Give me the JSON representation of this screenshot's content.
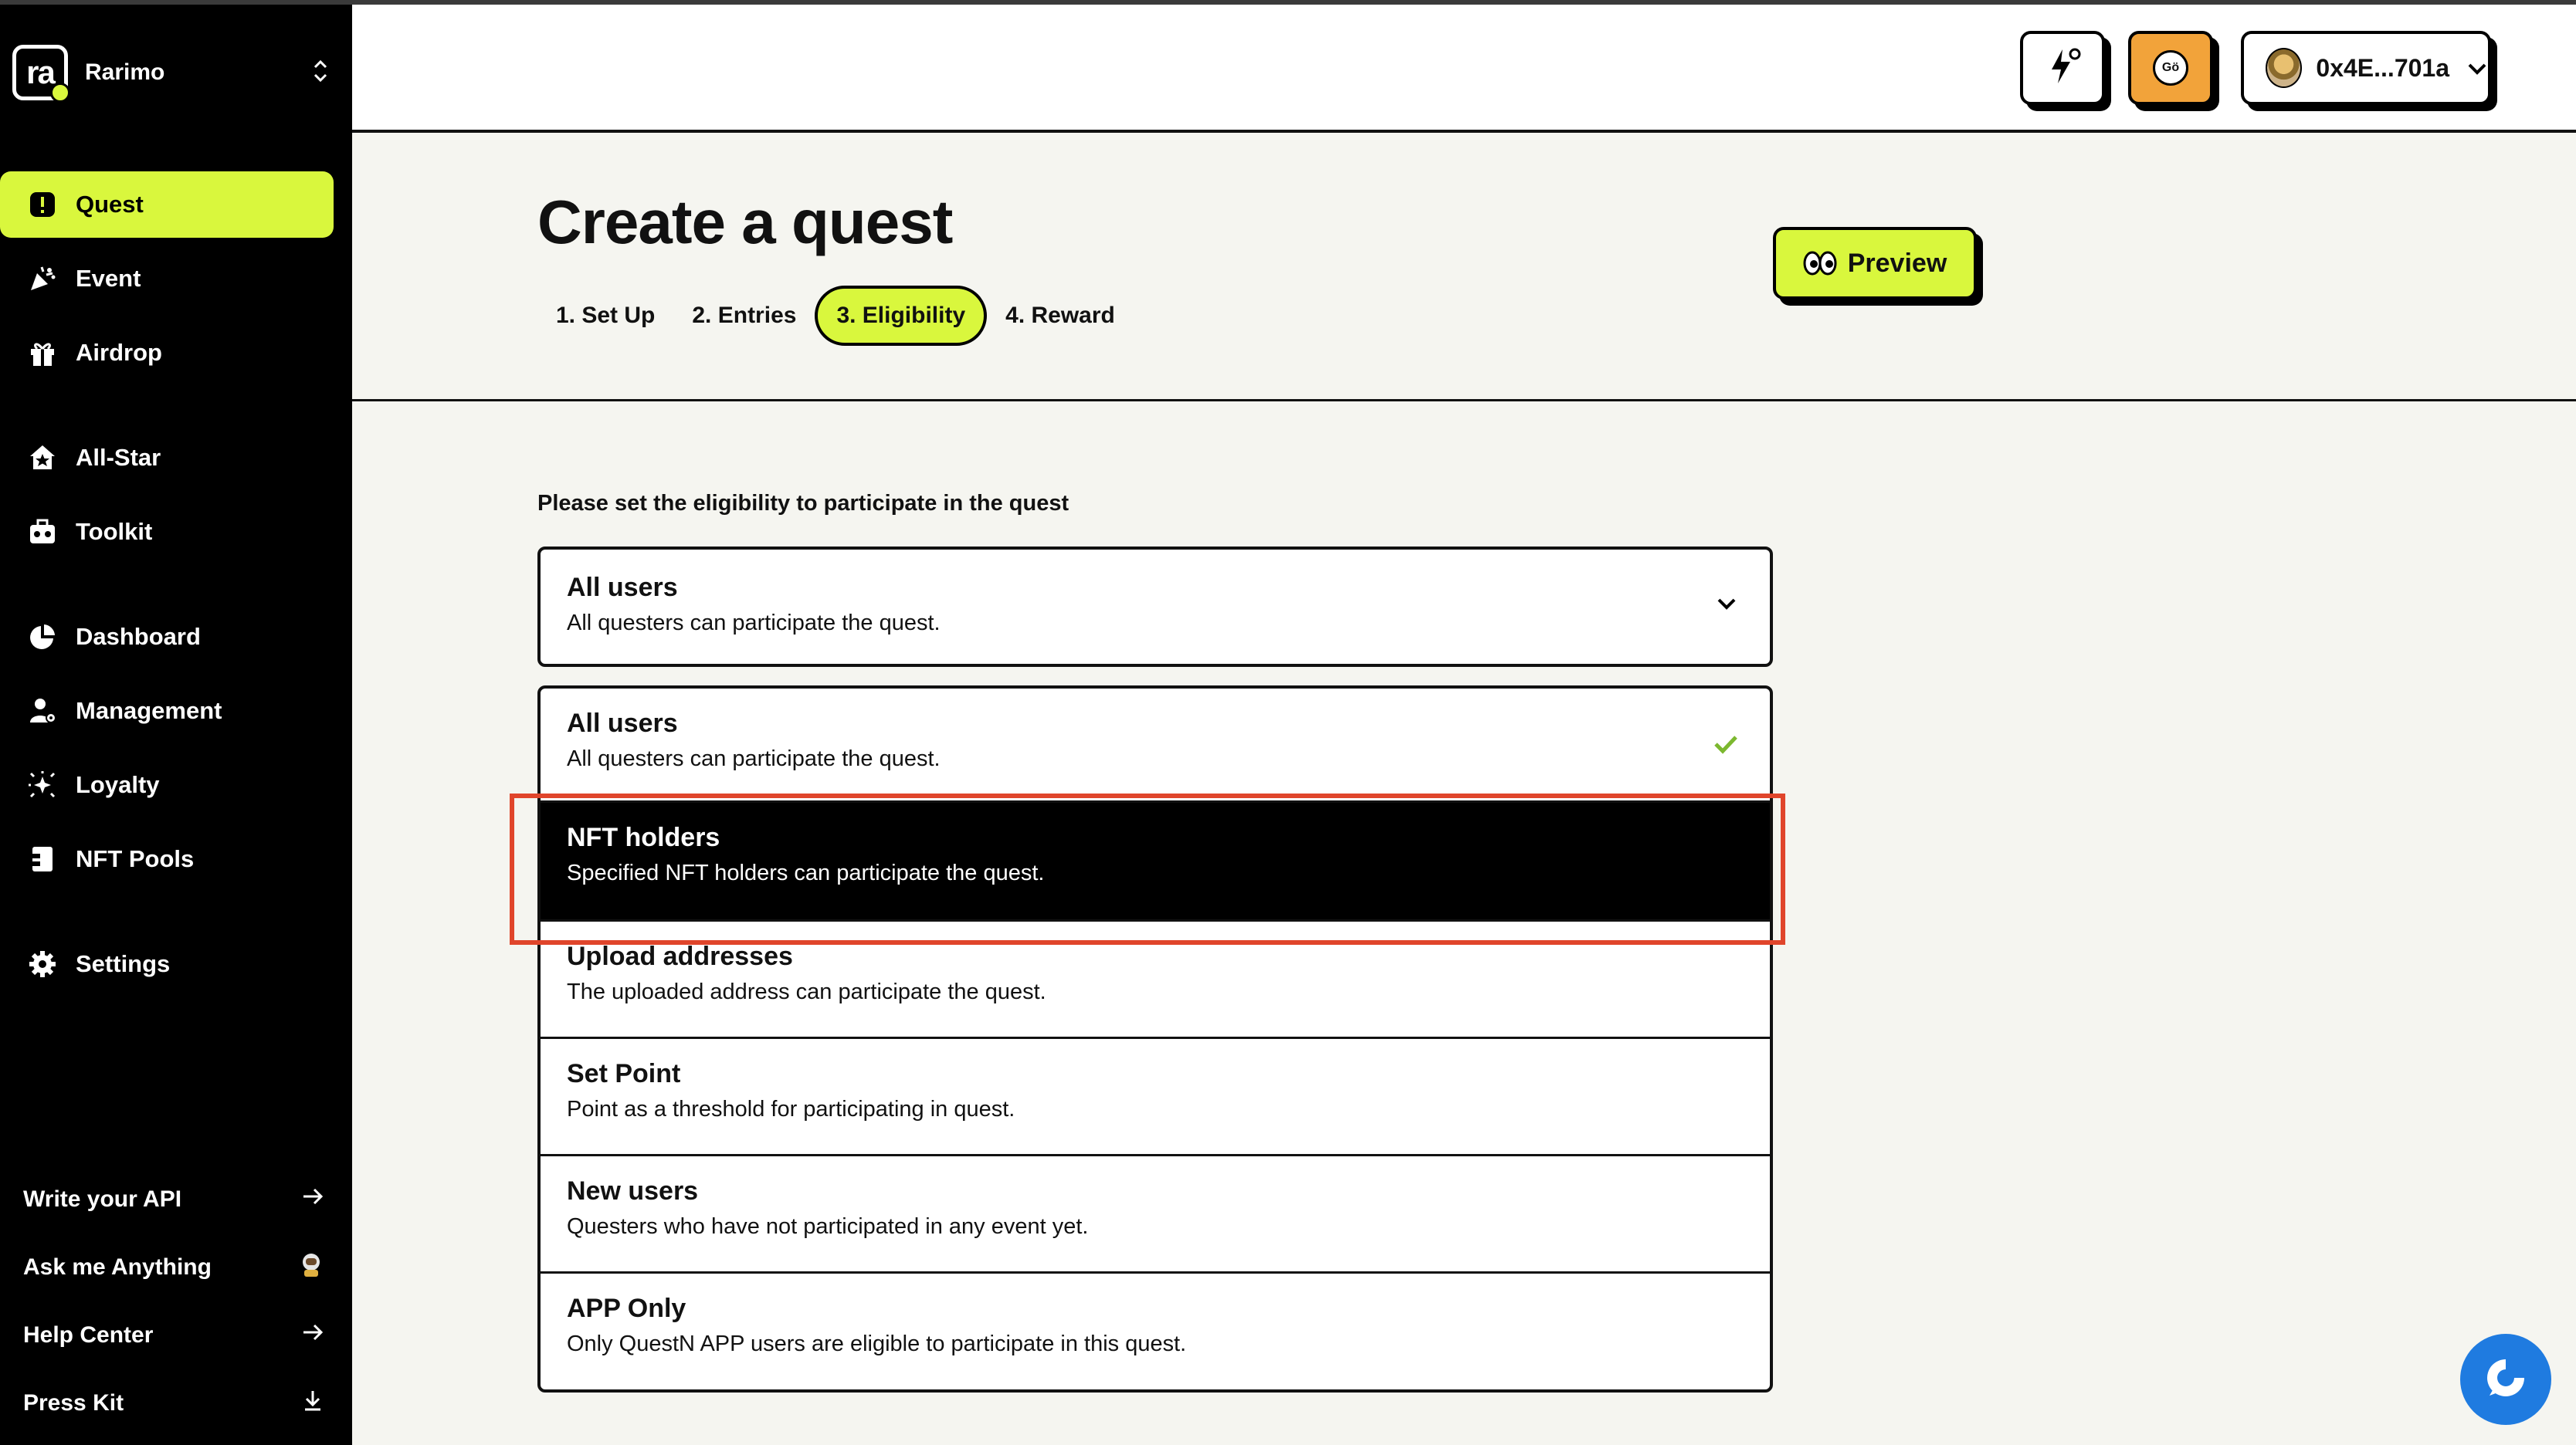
{
  "brand": {
    "name": "Rarimo",
    "logo_text": "ra"
  },
  "sidebar": {
    "items": [
      {
        "label": "Quest",
        "icon": "exclamation-icon",
        "active": true
      },
      {
        "label": "Event",
        "icon": "party-popper-icon"
      },
      {
        "label": "Airdrop",
        "icon": "gift-icon"
      },
      {
        "label": "All-Star",
        "icon": "star-house-icon"
      },
      {
        "label": "Toolkit",
        "icon": "toolkit-icon"
      },
      {
        "label": "Dashboard",
        "icon": "pie-chart-icon"
      },
      {
        "label": "Management",
        "icon": "user-gear-icon"
      },
      {
        "label": "Loyalty",
        "icon": "sparkle-icon"
      },
      {
        "label": "NFT Pools",
        "icon": "nft-pool-icon"
      },
      {
        "label": "Settings",
        "icon": "gear-icon"
      }
    ],
    "footer": [
      {
        "label": "Write your API",
        "icon": "arrow-right-icon"
      },
      {
        "label": "Ask me Anything",
        "icon": "astronaut-icon"
      },
      {
        "label": "Help Center",
        "icon": "arrow-right-icon"
      },
      {
        "label": "Press Kit",
        "icon": "download-icon"
      }
    ]
  },
  "header": {
    "coin_label": "Gö",
    "wallet_address": "0x4E...701a"
  },
  "page": {
    "title": "Create a quest",
    "preview_label": "Preview",
    "steps": [
      {
        "label": "1. Set Up"
      },
      {
        "label": "2. Entries"
      },
      {
        "label": "3. Eligibility",
        "active": true
      },
      {
        "label": "4. Reward"
      }
    ],
    "instruction": "Please set the eligibility to participate in the quest"
  },
  "eligibility": {
    "selected": {
      "title": "All users",
      "desc": "All questers can participate the quest."
    },
    "options": [
      {
        "title": "All users",
        "desc": "All questers can participate the quest.",
        "checked": true
      },
      {
        "title": "NFT holders",
        "desc": "Specified NFT holders can participate the quest.",
        "highlighted": true
      },
      {
        "title": "Upload addresses",
        "desc": "The uploaded address can participate the quest."
      },
      {
        "title": "Set Point",
        "desc": "Point as a threshold for participating in quest."
      },
      {
        "title": "New users",
        "desc": "Questers who have not participated in any event yet."
      },
      {
        "title": "APP Only",
        "desc": "Only QuestN APP users are eligible to participate in this quest."
      }
    ]
  },
  "colors": {
    "accent": "#d9f73d",
    "highlight_border": "#e0452b",
    "check": "#7cb82f",
    "chat_fab": "#1f7be0"
  }
}
